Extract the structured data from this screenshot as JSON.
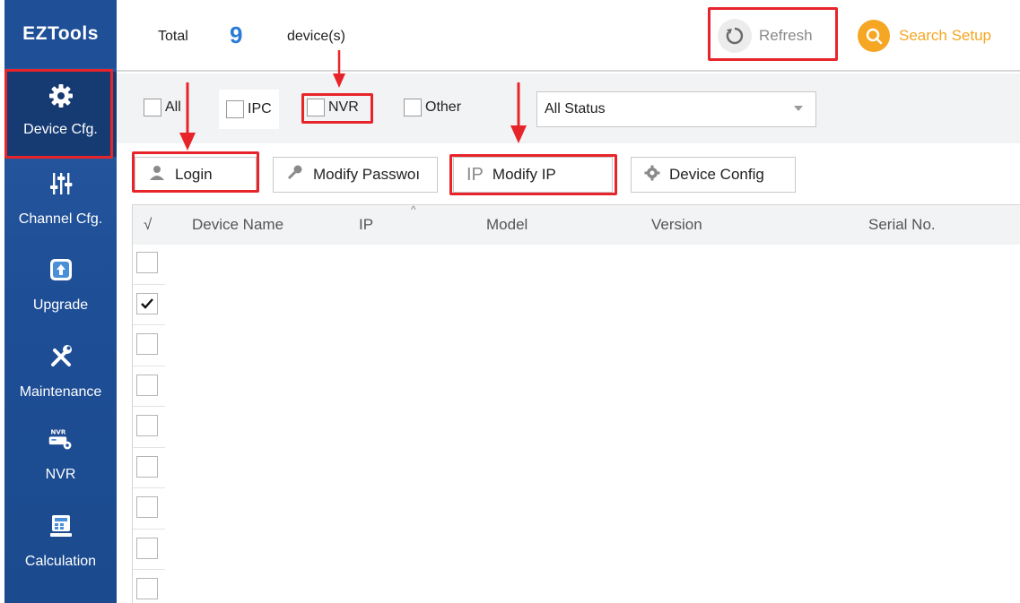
{
  "app": {
    "brand": "EZTools"
  },
  "sidebar": {
    "items": [
      {
        "label": "Device Cfg.",
        "icon": "gear-icon",
        "active": true
      },
      {
        "label": "Channel Cfg.",
        "icon": "sliders-icon"
      },
      {
        "label": "Upgrade",
        "icon": "upgrade-icon"
      },
      {
        "label": "Maintenance",
        "icon": "tools-icon"
      },
      {
        "label": "NVR",
        "icon": "nvr-icon"
      },
      {
        "label": "Calculation",
        "icon": "calculator-icon"
      }
    ]
  },
  "header": {
    "total_label": "Total",
    "count": "9",
    "unit": "device(s)",
    "refresh_label": "Refresh",
    "search_setup_label": "Search Setup"
  },
  "filters": {
    "all_label": "All",
    "ipc_label": "IPC",
    "nvr_label": "NVR",
    "other_label": "Other",
    "status_selected": "All Status"
  },
  "actions": {
    "login_label": "Login",
    "modify_password_label": "Modify Passwoı",
    "modify_ip_prefix": "IP",
    "modify_ip_label": "Modify IP",
    "device_config_label": "Device Config"
  },
  "table": {
    "columns": [
      "√",
      "Device Name",
      "IP",
      "Model",
      "Version",
      "Serial No."
    ],
    "rows_checked": [
      false,
      true,
      false,
      false,
      false,
      false,
      false,
      false,
      false
    ]
  },
  "colors": {
    "accent": "#2b7bd6",
    "sidebar": "#1f4f97",
    "highlight": "#e8242b",
    "search_setup": "#f5a623"
  }
}
